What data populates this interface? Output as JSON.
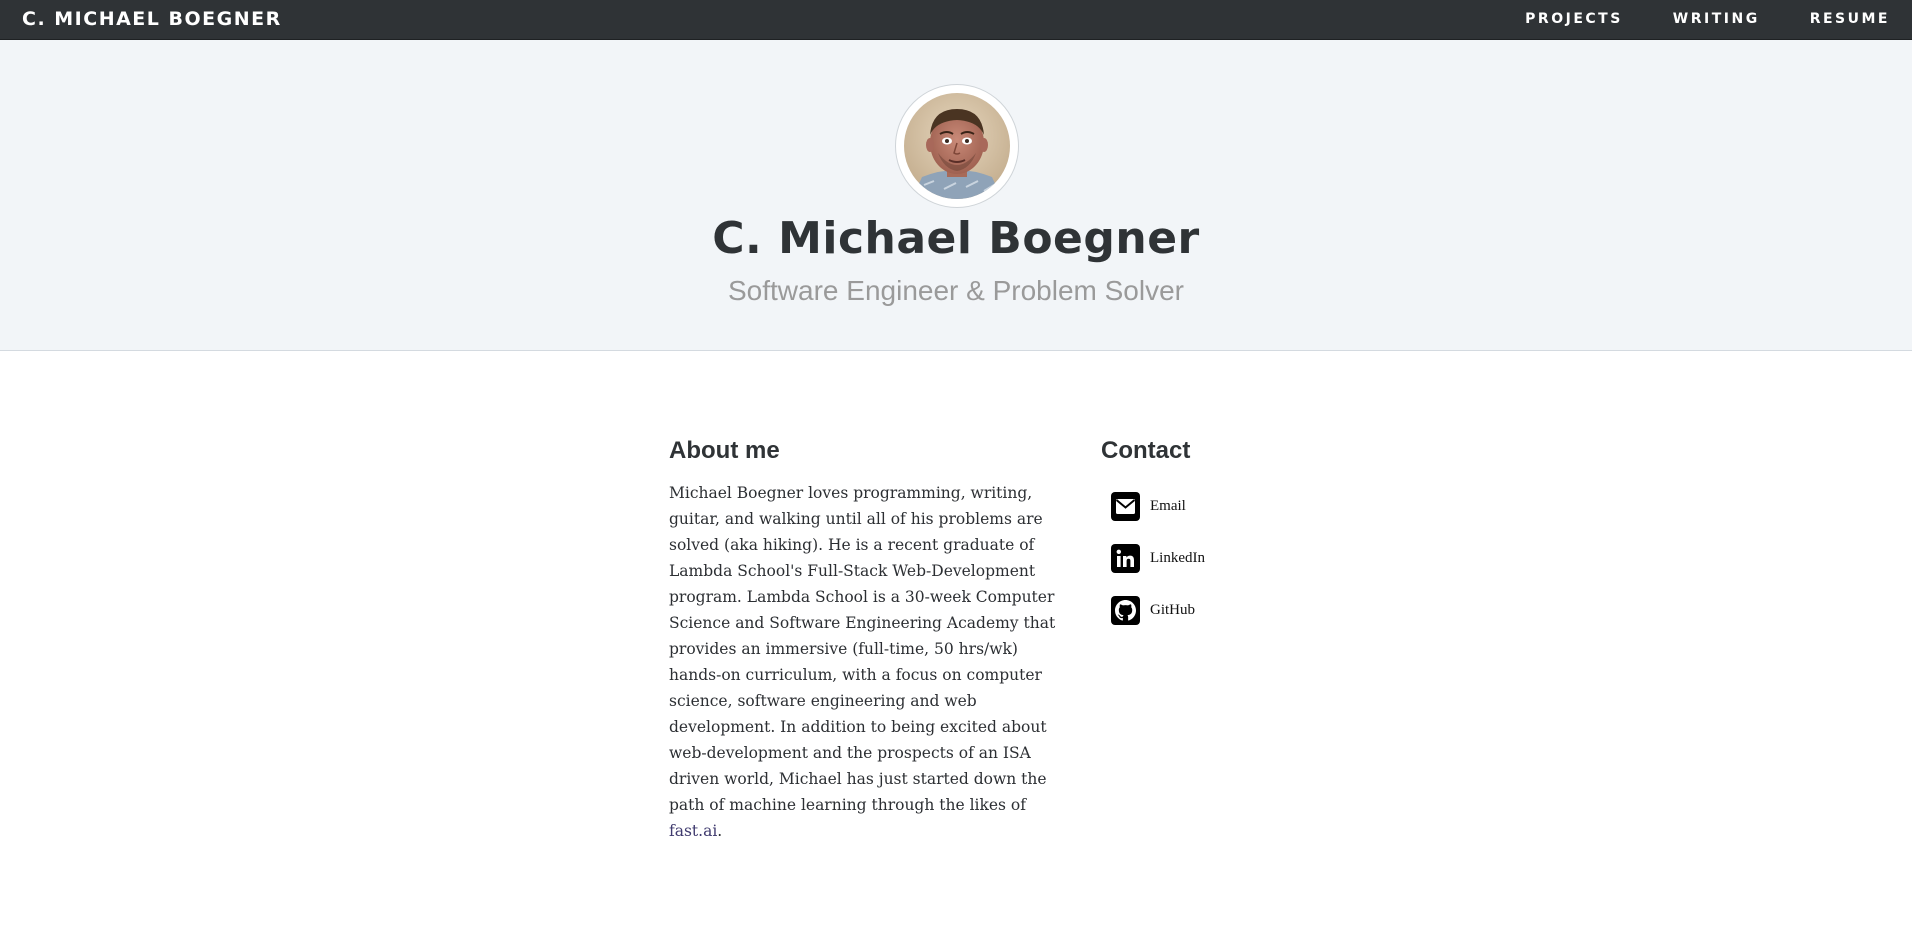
{
  "navbar": {
    "brand": "C. MICHAEL BOEGNER",
    "links": [
      {
        "label": "PROJECTS"
      },
      {
        "label": "WRITING"
      },
      {
        "label": "RESUME"
      }
    ],
    "background_color": "#2f3336"
  },
  "hero": {
    "avatar_icon": "profile-photo",
    "name": "C. Michael Boegner",
    "subtitle": "Software Engineer & Problem Solver",
    "background_color": "#f2f5f8"
  },
  "about": {
    "heading": "About me",
    "body": "Michael Boegner loves programming, writing, guitar, and walking until all of his problems are solved (aka hiking). He is a recent graduate of Lambda School's Full-Stack Web-Development program. Lambda School is a 30-week Computer Science and Software Engineering Academy that provides an immersive (full-time, 50 hrs/wk) hands-on curriculum, with a focus on computer science, software engineering and web development. In addition to being excited about web-development and the prospects of an ISA driven world, Michael has just started down the path of machine learning through the likes of ",
    "link_text": "fast.ai",
    "after_link": ".",
    "link_color": "#3f3a6e"
  },
  "contact": {
    "heading": "Contact",
    "items": [
      {
        "label": "Email",
        "icon": "envelope-icon"
      },
      {
        "label": "LinkedIn",
        "icon": "linkedin-icon"
      },
      {
        "label": "GitHub",
        "icon": "github-icon"
      }
    ]
  }
}
